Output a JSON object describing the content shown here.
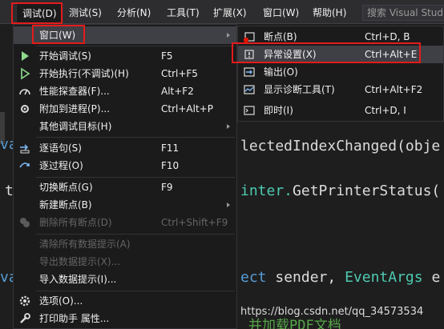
{
  "menubar": {
    "items": [
      {
        "label": "调试(D)"
      },
      {
        "label": "测试(S)"
      },
      {
        "label": "分析(N)"
      },
      {
        "label": "工具(T)"
      },
      {
        "label": "扩展(X)"
      },
      {
        "label": "窗口(W)"
      },
      {
        "label": "帮助(H)"
      }
    ],
    "search_placeholder": "搜索 Visual Studio"
  },
  "debug_menu": {
    "items": [
      {
        "label": "窗口(W)",
        "submenu": true
      },
      {
        "label": "开始调试(S)",
        "shortcut": "F5"
      },
      {
        "label": "开始执行(不调试)(H)",
        "shortcut": "Ctrl+F5"
      },
      {
        "label": "性能探查器(F)...",
        "shortcut": "Alt+F2"
      },
      {
        "label": "附加到进程(P)...",
        "shortcut": "Ctrl+Alt+P"
      },
      {
        "label": "其他调试目标(H)",
        "submenu": true
      },
      {
        "label": "逐语句(S)",
        "shortcut": "F11"
      },
      {
        "label": "逐过程(O)",
        "shortcut": "F10"
      },
      {
        "label": "切换断点(G)",
        "shortcut": "F9"
      },
      {
        "label": "新建断点(B)",
        "submenu": true
      },
      {
        "label": "删除所有断点(D)",
        "shortcut": "Ctrl+Shift+F9"
      },
      {
        "label": "清除所有数据提示(A)"
      },
      {
        "label": "导出数据提示(X)..."
      },
      {
        "label": "导入数据提示(I)..."
      },
      {
        "label": "选项(O)..."
      },
      {
        "label": "打印助手 属性..."
      }
    ]
  },
  "window_submenu": {
    "items": [
      {
        "label": "断点(B)",
        "shortcut": "Ctrl+D, B"
      },
      {
        "label": "异常设置(X)",
        "shortcut": "Ctrl+Alt+E"
      },
      {
        "label": "输出(O)"
      },
      {
        "label": "显示诊断工具(T)",
        "shortcut": "Ctrl+Alt+F2"
      },
      {
        "label": "即时(I)",
        "shortcut": "Ctrl+D, I"
      }
    ]
  },
  "code": {
    "line1": "lectedIndexChanged(obje",
    "line2a": "inter.",
    "line2b": "GetPrinterStatus(",
    "line3a": "ect",
    "line3b": "sender,",
    "line3c": "EventArgs",
    "line3d": "e",
    "left1": "va",
    "left2": "t",
    "left3": "va",
    "bottom": "并加载PDF文档"
  },
  "watermark": "https://blog.csdn.net/qq_34573534",
  "colors": {
    "highlight_red": "#e31c1c",
    "menu_bg": "#1b1b1c",
    "hover_bg": "#3f3f46"
  }
}
